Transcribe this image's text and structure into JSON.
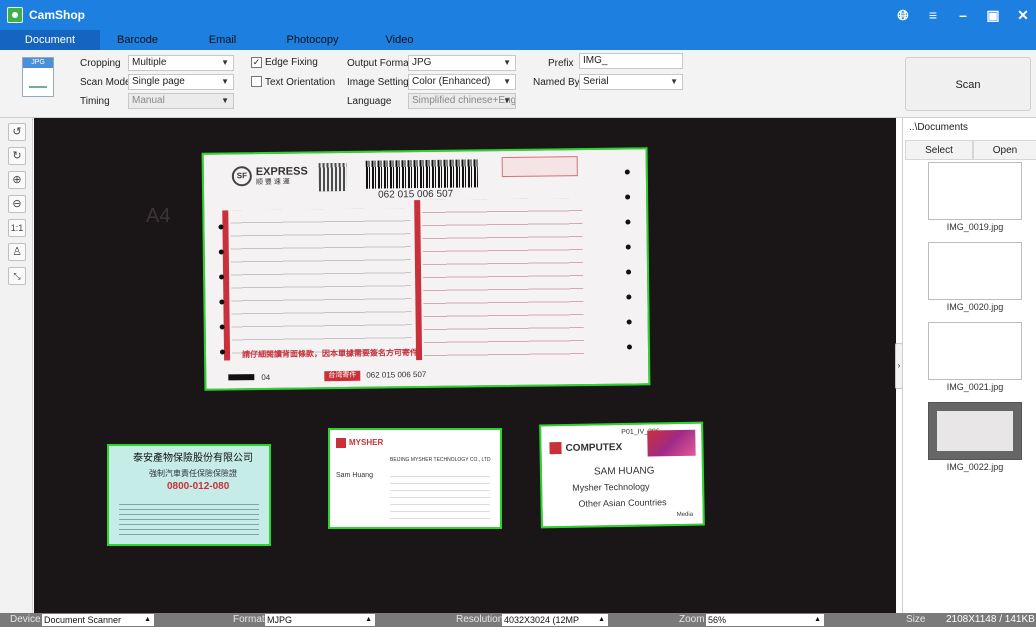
{
  "app": {
    "title": "CamShop"
  },
  "tabs": [
    {
      "label": "Document",
      "active": true
    },
    {
      "label": "Barcode"
    },
    {
      "label": "Email"
    },
    {
      "label": "Photocopy"
    },
    {
      "label": "Video"
    }
  ],
  "toolbar": {
    "format_icon_text": "JPG",
    "cropping_label": "Cropping",
    "cropping_value": "Multiple",
    "scan_mode_label": "Scan Mode",
    "scan_mode_value": "Single page",
    "timing_label": "Timing",
    "timing_value": "Manual",
    "edge_fixing_label": "Edge Fixing",
    "edge_fixing_checked": true,
    "text_orientation_label": "Text Orientation",
    "text_orientation_checked": false,
    "output_format_label": "Output Format",
    "output_format_value": "JPG",
    "image_settings_label": "Image Settings",
    "image_settings_value": "Color (Enhanced)",
    "language_label": "Language",
    "language_value": "Simplified chinese+Eng",
    "prefix_label": "Prefix",
    "prefix_value": "IMG_",
    "named_by_label": "Named By",
    "named_by_value": "Serial",
    "scan_label": "Scan"
  },
  "tools": [
    "rotate-left-icon",
    "rotate-right-icon",
    "zoom-in-icon",
    "zoom-out-icon",
    "actual-size-icon",
    "stamp-icon",
    "fit-icon"
  ],
  "preview": {
    "a4_watermark": "A4",
    "waybill": {
      "brand": "EXPRESS",
      "brand_cn": "顺 豐 速 運",
      "tracking": "062 015 006 507",
      "tracking_footer": "062 015 006 507",
      "footer_tag": "台湾寄件",
      "footer_num": "04",
      "red_notice": "請仔細閱讀背面條款，因本單據需要簽名方可寄件"
    },
    "card_insurance": {
      "company": "泰安產物保險股份有限公司",
      "sub": "強制汽車責任保險保險證",
      "hotline": "0800-012-080"
    },
    "card_mysher": {
      "logo": "MYSHER",
      "company": "BEIJING MYSHER TECHNOLOGY CO., LTD",
      "name": "Sam Huang"
    },
    "card_computex": {
      "code": "P01_IV_396",
      "logo": "COMPUTEX",
      "name": "SAM HUANG",
      "company": "Mysher Technology",
      "region": "Other Asian Countries",
      "footer": "Media"
    }
  },
  "right_panel": {
    "path": "..\\Documents",
    "select_label": "Select",
    "open_label": "Open",
    "thumbnails": [
      {
        "name": "IMG_0019.jpg",
        "selected": false
      },
      {
        "name": "IMG_0020.jpg",
        "selected": false
      },
      {
        "name": "IMG_0021.jpg",
        "selected": false
      },
      {
        "name": "IMG_0022.jpg",
        "selected": true
      }
    ]
  },
  "status": {
    "device_label": "Device",
    "device_value": "Document Scanner",
    "format_label": "Format",
    "format_value": "MJPG",
    "resolution_label": "Resolution",
    "resolution_value": "4032X3024 (12MP",
    "zoom_label": "Zoom",
    "zoom_value": "56%",
    "size_label": "Size",
    "size_value": "2108X1148 / 141KB"
  },
  "colors": {
    "title_bar": "#1d7fe0",
    "crop_outline": "#2bd62b",
    "preview_bg": "#1a1617"
  }
}
